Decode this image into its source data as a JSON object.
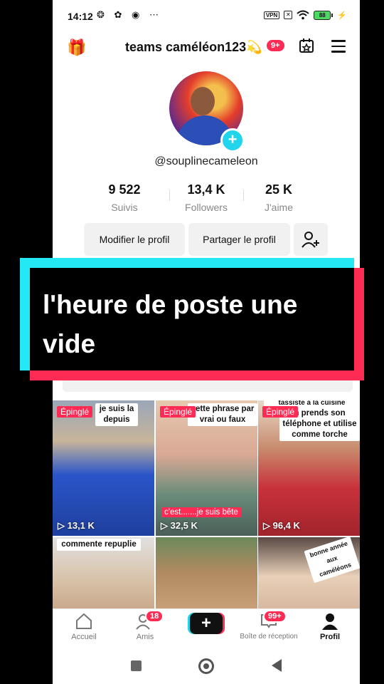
{
  "status": {
    "time": "14:12",
    "icons": "❂ ✿ ◉ ⋯",
    "vpn": "VPN",
    "battery": "88"
  },
  "header": {
    "username": "teams caméléon123💫",
    "notif_badge": "9+"
  },
  "profile": {
    "handle": "@souplinecameleon"
  },
  "stats": [
    {
      "value": "9 522",
      "label": "Suivis"
    },
    {
      "value": "13,4 K",
      "label": "Followers"
    },
    {
      "value": "25 K",
      "label": "J'aime"
    }
  ],
  "actions": {
    "edit": "Modifier le profil",
    "share": "Partager le profil"
  },
  "overlay": {
    "text": "l'heure de poste une vide"
  },
  "videos": [
    {
      "pinned": "Épinglé",
      "caption": "je suis la depuis",
      "views": "13,1 K"
    },
    {
      "pinned": "Épinglé",
      "caption": "cette phrase par vrai ou faux",
      "caption2": "c'est.......je suis bête",
      "views": "32,5 K"
    },
    {
      "pinned": "Épinglé",
      "caption": "h prends son téléphone et utilise comme torche",
      "caption_top": "tassiste à la cuisine",
      "views": "96,4 K"
    },
    {
      "caption": "commente repuplie"
    },
    {
      "caption": ""
    },
    {
      "caption": "bonne année aux caméléons"
    }
  ],
  "nav": {
    "home": "Accueil",
    "friends": "Amis",
    "friends_badge": "18",
    "inbox": "Boîte de réception",
    "inbox_badge": "99+",
    "profile": "Profil"
  },
  "colors": {
    "accent": "#fe2c55",
    "cyan": "#25e8f5"
  }
}
